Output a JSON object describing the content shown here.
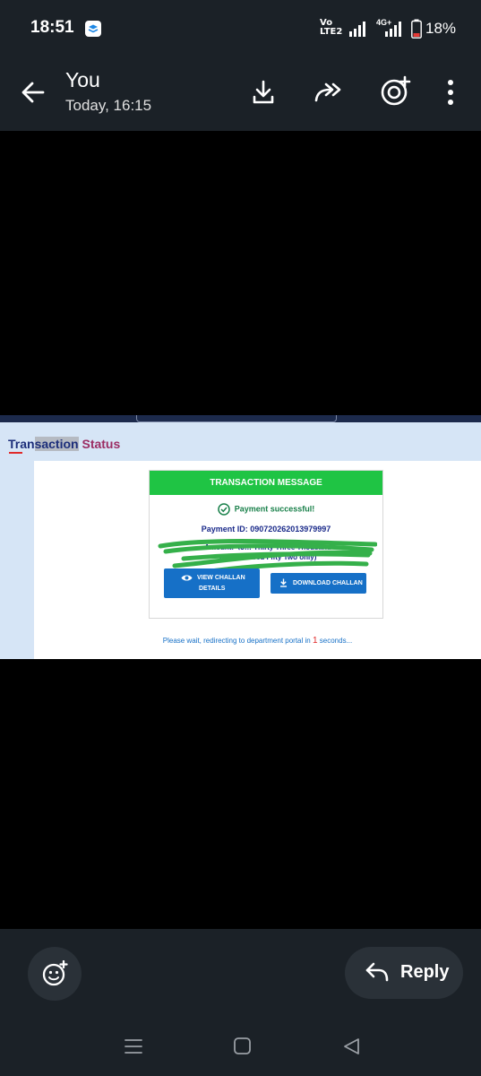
{
  "status_bar": {
    "time": "18:51",
    "volte_top": "Vo",
    "volte_bottom": "LTE2",
    "network": "4G+",
    "battery": "18%"
  },
  "header": {
    "title": "You",
    "subtitle": "Today, 16:15",
    "icons": [
      "back-arrow-icon",
      "download-icon",
      "forward-icon",
      "add-sticker-icon",
      "more-vert-icon"
    ]
  },
  "image": {
    "heading_part1": "Tran",
    "heading_part2": "saction",
    "heading_part3": "Status",
    "card_header": "TRANSACTION MESSAGE",
    "success_text": "Payment successful!",
    "payment_id": "Payment ID: 090720262013979997",
    "amount_line1": "Amount: ₹3… Thirty Three Thousand",
    "amount_line2": "One Hundred Fifty Two only)",
    "view_challan_label_1": "VIEW CHALLAN",
    "view_challan_label_2": "DETAILS",
    "download_challan_label": "DOWNLOAD CHALLAN",
    "redirect_prefix": "Please wait, redirecting to department portal in",
    "redirect_count": "1",
    "redirect_suffix": "seconds..."
  },
  "footer": {
    "reply_label": "Reply",
    "icons": [
      "emoji-add-icon",
      "reply-arrow-icon"
    ]
  },
  "nav_bar": {
    "icons": [
      "recents-icon",
      "home-icon",
      "back-icon"
    ]
  },
  "colors": {
    "bar_bg": "#1b2127",
    "green_header": "#1fc444",
    "button_blue": "#1670c7",
    "scribble_green": "#35b04a"
  }
}
